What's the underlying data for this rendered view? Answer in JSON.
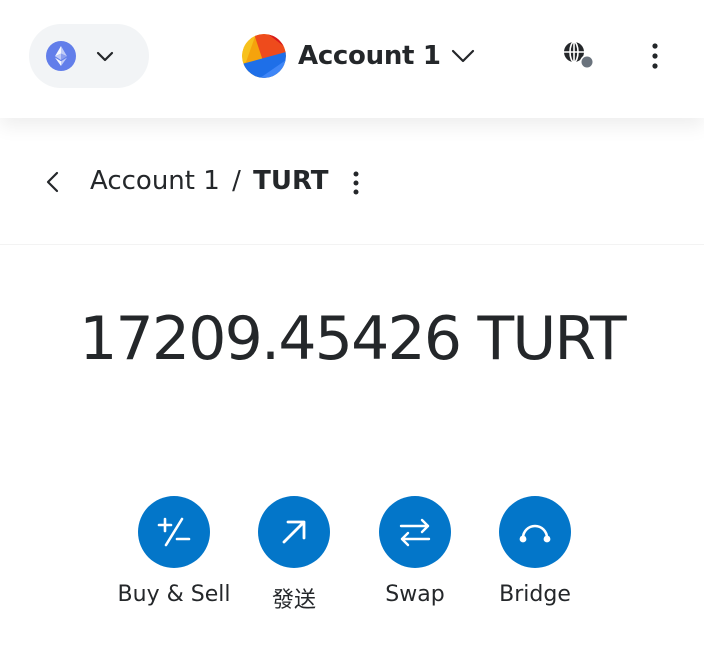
{
  "header": {
    "network": {
      "icon": "ethereum-icon",
      "chevron_icon": "chevron-down-icon"
    },
    "account": {
      "name": "Account 1",
      "avatar_icon": "account-avatar",
      "chevron_icon": "chevron-down-icon"
    },
    "connection_icon": "globe-connection-icon",
    "menu_icon": "kebab-menu-icon"
  },
  "page": {
    "back_icon": "chevron-left-icon",
    "breadcrumb": {
      "account": "Account 1",
      "separator": "/",
      "token": "TURT"
    },
    "menu_icon": "kebab-menu-icon"
  },
  "balance": {
    "text": "17209.45426 TURT"
  },
  "actions": [
    {
      "label": "Buy & Sell",
      "icon": "plus-minus-icon"
    },
    {
      "label": "發送",
      "icon": "arrow-up-right-icon"
    },
    {
      "label": "Swap",
      "icon": "swap-arrows-icon"
    },
    {
      "label": "Bridge",
      "icon": "bridge-icon"
    }
  ],
  "colors": {
    "accent": "#0376c9",
    "text": "#24272a",
    "network_pill_bg": "#f2f4f6",
    "ethereum": "#627eea"
  }
}
